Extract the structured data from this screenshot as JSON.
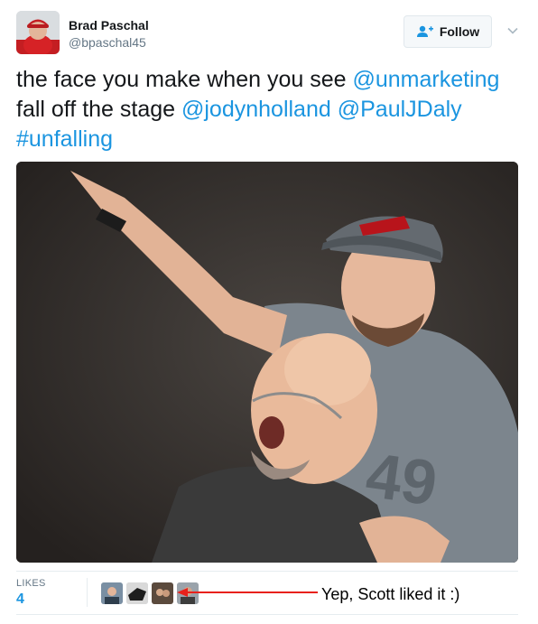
{
  "tweet": {
    "author": {
      "name": "Brad Paschal",
      "handle": "@bpaschal45"
    },
    "follow_label": "Follow",
    "text": {
      "part1": "the face you make when you see ",
      "mention1": "@unmarketing",
      "part2": " fall off the stage ",
      "mention2": "@jodynholland",
      "part3": " ",
      "mention3": "@PaulJDaly",
      "part4": " ",
      "hashtag": "#unfalling"
    },
    "stats": {
      "likes_label": "LIKES",
      "likes_count": "4"
    }
  },
  "annotation": {
    "text": "Yep, Scott liked it :)"
  },
  "colors": {
    "link": "#1b95e0",
    "arrow": "#e8211c",
    "muted": "#657786"
  },
  "icons": [
    "follow-person-plus-icon",
    "chevron-down-icon"
  ]
}
